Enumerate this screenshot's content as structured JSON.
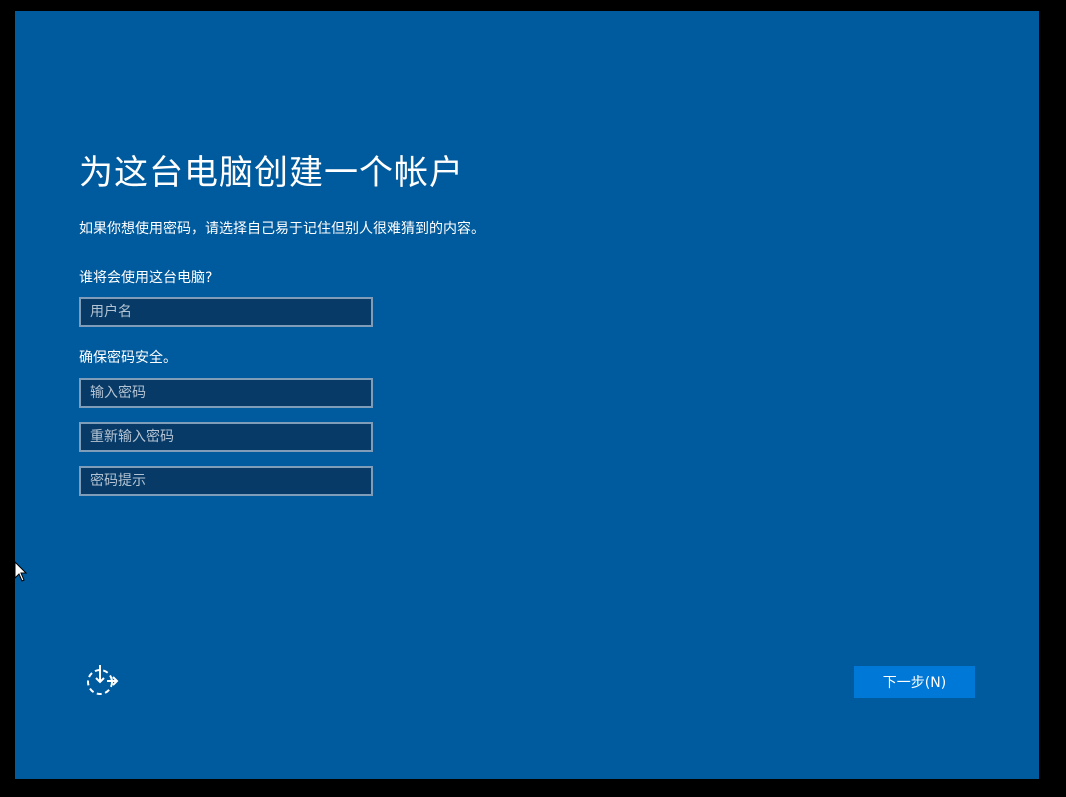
{
  "setup": {
    "title": "为这台电脑创建一个帐户",
    "description": "如果你想使用密码，请选择自己易于记住但别人很难猜到的内容。",
    "user_section_label": "谁将会使用这台电脑?",
    "username_placeholder": "用户名",
    "password_section_label": "确保密码安全。",
    "password_placeholder": "输入密码",
    "confirm_password_placeholder": "重新输入密码",
    "password_hint_placeholder": "密码提示",
    "next_button_label": "下一步(N)",
    "ease_of_access_icon": "ease-of-access-icon"
  },
  "colors": {
    "background": "#005a9e",
    "outer": "#000000",
    "accent_button": "#0078d7",
    "field_fill": "#073a66",
    "field_border": "#7f9cb8"
  }
}
